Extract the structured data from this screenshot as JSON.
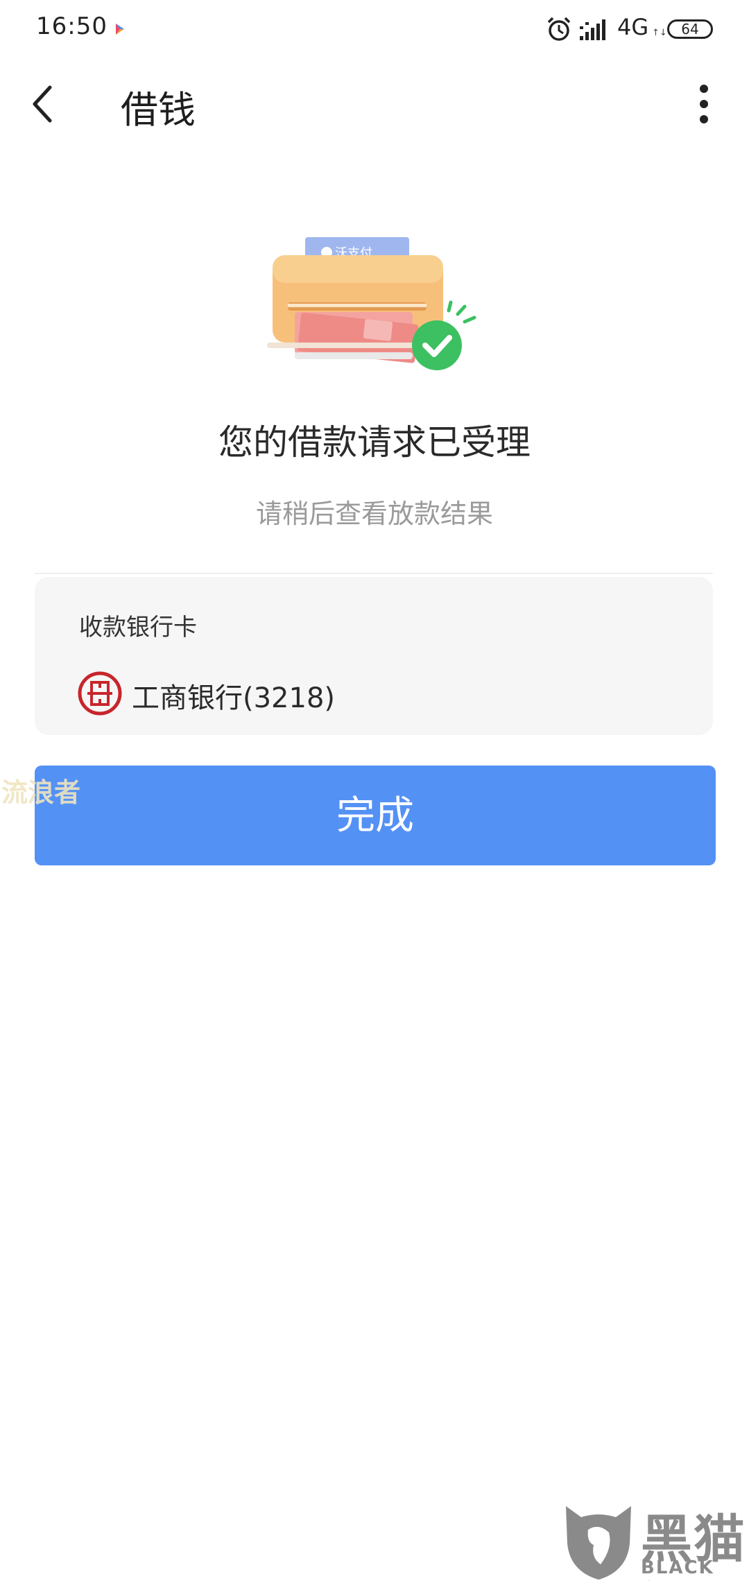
{
  "status_bar": {
    "time": "16:50",
    "network": "4G",
    "network_arrows": "↑↓",
    "battery": "64",
    "icons": [
      "app-notification-icon",
      "alarm-icon",
      "signal-icon",
      "battery-icon"
    ]
  },
  "nav": {
    "title": "借钱",
    "back_icon": "back-arrow-icon",
    "more_icon": "more-vertical-icon"
  },
  "illustration": {
    "label": "沃支付",
    "icon": "printer-success-illustration",
    "accent_color": "#3cc062"
  },
  "result": {
    "title": "您的借款请求已受理",
    "subtitle": "请稍后查看放款结果"
  },
  "bank_card": {
    "label": "收款银行卡",
    "bank_name": "工商银行(3218)",
    "logo_icon": "icbc-logo-icon"
  },
  "actions": {
    "done_label": "完成",
    "done_color": "#5491f5"
  },
  "watermarks": {
    "left_text": "流浪者",
    "corner_cn": "黑猫",
    "corner_en": "BLACK CAT"
  }
}
